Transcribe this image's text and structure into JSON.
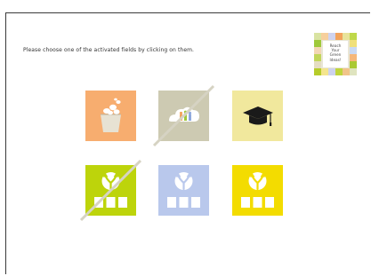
{
  "instruction": "Please choose one of the activated fields by clicking on them.",
  "logo": {
    "lines": [
      "Reach",
      "Your",
      "Green",
      "Ideas!"
    ]
  },
  "tiles": [
    {
      "name": "seeds",
      "icon": "seed-pot-icon",
      "color": "#f7ad6f",
      "active": true
    },
    {
      "name": "cloud-people",
      "icon": "cloud-people-icon",
      "color": "#cdcab2",
      "active": false
    },
    {
      "name": "graduation",
      "icon": "graduation-cap-icon",
      "color": "#f1e89d",
      "active": true
    },
    {
      "name": "fork-green",
      "icon": "fork-boxes-icon",
      "color": "#bdd40b",
      "active": false
    },
    {
      "name": "fork-blue",
      "icon": "fork-boxes-icon",
      "color": "#b9c8ec",
      "active": true
    },
    {
      "name": "fork-yellow",
      "icon": "fork-boxes-icon",
      "color": "#f3dc00",
      "active": true
    }
  ]
}
